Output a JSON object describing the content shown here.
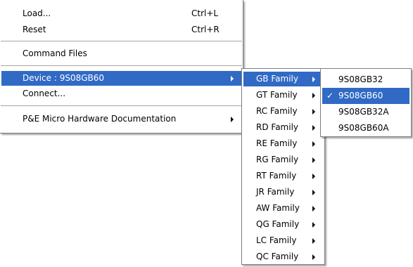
{
  "main_menu": {
    "items": [
      {
        "label": "Load...",
        "shortcut": "Ctrl+L"
      },
      {
        "label": "Reset",
        "shortcut": "Ctrl+R"
      },
      {
        "label": "Command Files"
      },
      {
        "label": "Device : 9S08GB60"
      },
      {
        "label": "Connect..."
      },
      {
        "label": "P&E Micro Hardware Documentation"
      }
    ]
  },
  "family_menu": {
    "items": [
      {
        "label": "GB Family"
      },
      {
        "label": "GT Family"
      },
      {
        "label": "RC Family"
      },
      {
        "label": "RD Family"
      },
      {
        "label": "RE Family"
      },
      {
        "label": "RG Family"
      },
      {
        "label": "RT Family"
      },
      {
        "label": "JR Family"
      },
      {
        "label": "AW Family"
      },
      {
        "label": "QG Family"
      },
      {
        "label": "LC Family"
      },
      {
        "label": "QC Family"
      }
    ]
  },
  "device_menu": {
    "items": [
      {
        "label": "9S08GB32",
        "checked": false
      },
      {
        "label": "9S08GB60",
        "checked": true
      },
      {
        "label": "9S08GB32A",
        "checked": false
      },
      {
        "label": "9S08GB60A",
        "checked": false
      }
    ],
    "check_glyph": "✓"
  },
  "colors": {
    "highlight": "#316ac5",
    "highlight_text": "#ffffff"
  }
}
